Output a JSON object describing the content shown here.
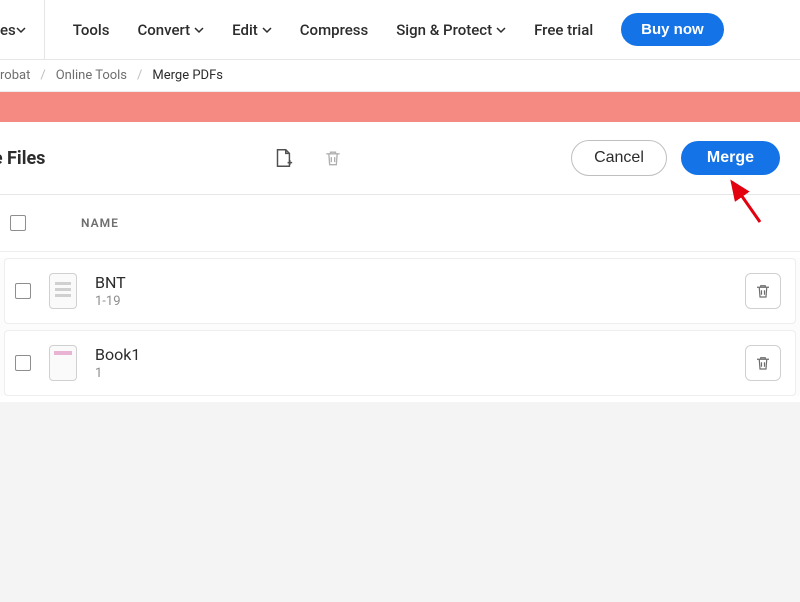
{
  "nav": {
    "partial": "es",
    "items": [
      "Tools",
      "Convert",
      "Edit",
      "Compress",
      "Sign & Protect",
      "Free trial"
    ],
    "dropdown_flags": [
      false,
      true,
      true,
      false,
      true,
      false
    ],
    "buy": "Buy now"
  },
  "breadcrumb": {
    "items": [
      "robat",
      "Online Tools",
      "Merge PDFs"
    ]
  },
  "toolbar": {
    "title": "ine Files",
    "cancel": "Cancel",
    "merge": "Merge"
  },
  "list": {
    "header": "NAME",
    "files": [
      {
        "name": "BNT",
        "pages": "1-19",
        "thumb": "doc"
      },
      {
        "name": "Book1",
        "pages": "1",
        "thumb": "book"
      }
    ]
  }
}
